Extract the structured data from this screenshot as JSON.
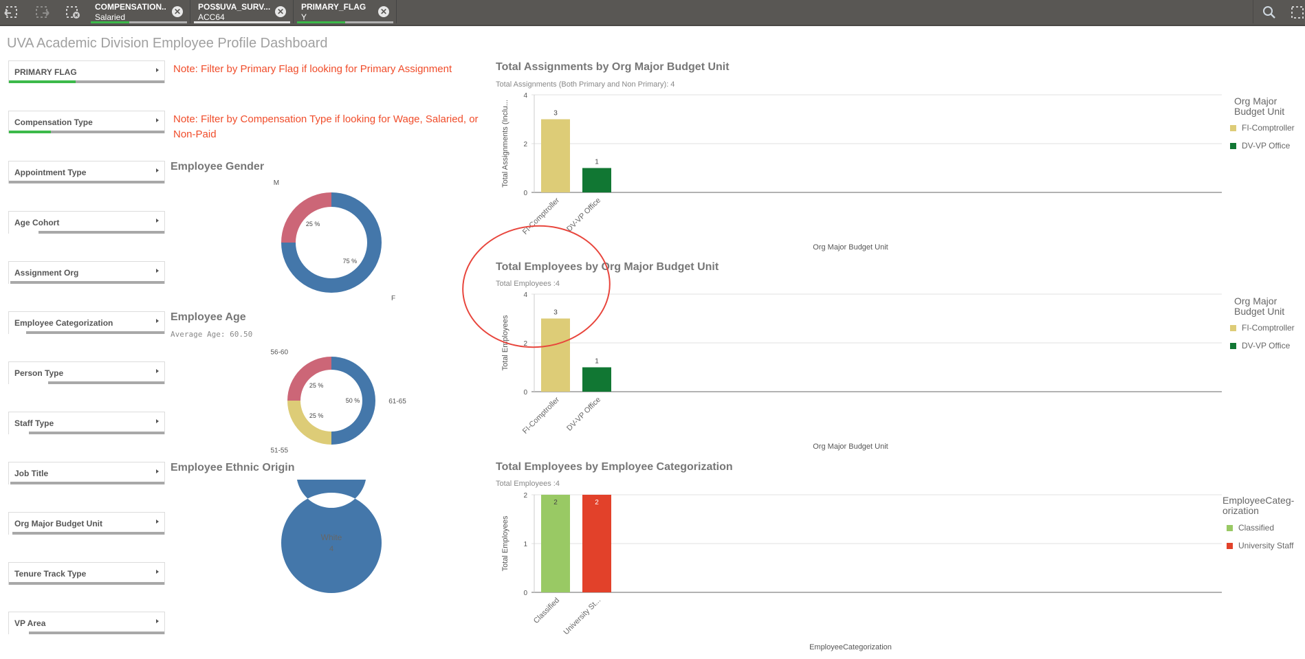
{
  "toolbar": {
    "icons": [
      "step-back-icon",
      "step-forward-icon",
      "clear-selections-icon"
    ],
    "selections": [
      {
        "field": "COMPENSATION..",
        "value": "Salaried",
        "fill": 0.4
      },
      {
        "field": "POS$UVA_SURV...",
        "value": "ACC64",
        "fill": 1.0
      },
      {
        "field": "PRIMARY_FLAG",
        "value": "Y",
        "fill": 0.5
      }
    ],
    "right_icons": [
      "search-icon",
      "smart-search-icon"
    ]
  },
  "page_title": "UVA Academic Division Employee Profile Dashboard",
  "filters": [
    {
      "label": "PRIMARY FLAG",
      "selected_fraction": 0.43,
      "color": "#3cb94a"
    },
    {
      "label": "Compensation Type",
      "selected_fraction": 0.27,
      "color": "#3cb94a"
    },
    {
      "label": "Appointment Type",
      "selected_fraction": 0,
      "color": "#ffffff"
    },
    {
      "label": "Age Cohort",
      "selected_fraction": 0,
      "white_fraction": 0.15
    },
    {
      "label": "Assignment Org",
      "selected_fraction": 0,
      "white_fraction": 0.01
    },
    {
      "label": "Employee Categorization",
      "selected_fraction": 0,
      "white_fraction": 0.09
    },
    {
      "label": "Person Type",
      "selected_fraction": 0,
      "white_fraction": 0.2
    },
    {
      "label": "Staff Type",
      "selected_fraction": 0,
      "white_fraction": 0.1
    },
    {
      "label": "Job Title",
      "selected_fraction": 0,
      "white_fraction": 0.01
    },
    {
      "label": "Org Major Budget Unit",
      "selected_fraction": 0,
      "white_fraction": 0.02
    },
    {
      "label": "Tenure Track Type",
      "selected_fraction": 0,
      "white_fraction": 0
    },
    {
      "label": "VP Area",
      "selected_fraction": 0,
      "white_fraction": 0.1
    }
  ],
  "notes": {
    "primary_flag": "Note: Filter by Primary Flag if looking for Primary Assignment",
    "compensation_line1": "Note: Filter by Compensation Type if looking for Wage, Salaried, or",
    "compensation_line2": "Non-Paid"
  },
  "colors": {
    "blue": "#4477aa",
    "pink": "#cc6677",
    "yellow": "#ddcc77",
    "green_dark": "#117733",
    "green_light": "#99c964",
    "red": "#e2412a",
    "annotation": "#e8453c"
  },
  "chart_data": [
    {
      "id": "gender",
      "type": "pie",
      "title": "Employee Gender",
      "donut": true,
      "slices": [
        {
          "label": "F",
          "value": 75,
          "pct_label": "75 %",
          "color": "#4477aa"
        },
        {
          "label": "M",
          "value": 25,
          "pct_label": "25 %",
          "color": "#cc6677"
        }
      ]
    },
    {
      "id": "age",
      "type": "pie",
      "title": "Employee Age",
      "subtitle": "Average Age: 60.50",
      "donut": true,
      "slices": [
        {
          "label": "61-65",
          "value": 50,
          "pct_label": "50 %",
          "color": "#4477aa"
        },
        {
          "label": "51-55",
          "value": 25,
          "pct_label": "25 %",
          "color": "#ddcc77"
        },
        {
          "label": "56-60",
          "value": 25,
          "pct_label": "25 %",
          "color": "#cc6677"
        }
      ]
    },
    {
      "id": "ethnic",
      "type": "pie",
      "title": "Employee Ethnic Origin",
      "donut": true,
      "center_label": "White",
      "center_value": "4",
      "slices": [
        {
          "label": "White",
          "value": 4,
          "color": "#4477aa"
        }
      ]
    },
    {
      "id": "assignments",
      "type": "bar",
      "title": "Total Assignments by Org Major Budget Unit",
      "subtitle": "Total Assignments (Both Primary and Non Primary): 4",
      "categories": [
        "FI-Comptroller",
        "DV-VP Office"
      ],
      "values": [
        3,
        1
      ],
      "colors": [
        "#ddcc77",
        "#117733"
      ],
      "xlabel": "Org Major Budget Unit",
      "ylabel": "Total Assignments (Inclu...",
      "yticks": [
        0,
        2,
        4
      ],
      "ylim": [
        0,
        4
      ],
      "legend_title": "Org Major Budget Unit",
      "legend": [
        "FI-Comptroller",
        "DV-VP Office"
      ],
      "legend_position": "right",
      "grid": true
    },
    {
      "id": "employees_org",
      "type": "bar",
      "title": "Total Employees by Org Major Budget Unit",
      "subtitle": "Total Employees :4",
      "categories": [
        "FI-Comptroller",
        "DV-VP Office"
      ],
      "values": [
        3,
        1
      ],
      "colors": [
        "#ddcc77",
        "#117733"
      ],
      "xlabel": "Org Major Budget Unit",
      "ylabel": "Total Employees",
      "yticks": [
        0,
        2,
        4
      ],
      "ylim": [
        0,
        4
      ],
      "legend_title": "Org Major Budget Unit",
      "legend": [
        "FI-Comptroller",
        "DV-VP Office"
      ],
      "legend_position": "right",
      "grid": true
    },
    {
      "id": "employees_cat",
      "type": "bar",
      "title": "Total Employees by Employee Categorization",
      "subtitle": "Total Employees :4",
      "categories": [
        "Classified",
        "University St..."
      ],
      "values": [
        2,
        2
      ],
      "colors": [
        "#99c964",
        "#e2412a"
      ],
      "xlabel": "EmployeeCategorization",
      "ylabel": "Total Employees",
      "yticks": [
        0,
        1,
        2
      ],
      "ylim": [
        0,
        2
      ],
      "legend_title": "EmployeeCateg-orization",
      "legend": [
        "Classified",
        "University Staff"
      ],
      "legend_position": "right",
      "grid": true
    }
  ]
}
